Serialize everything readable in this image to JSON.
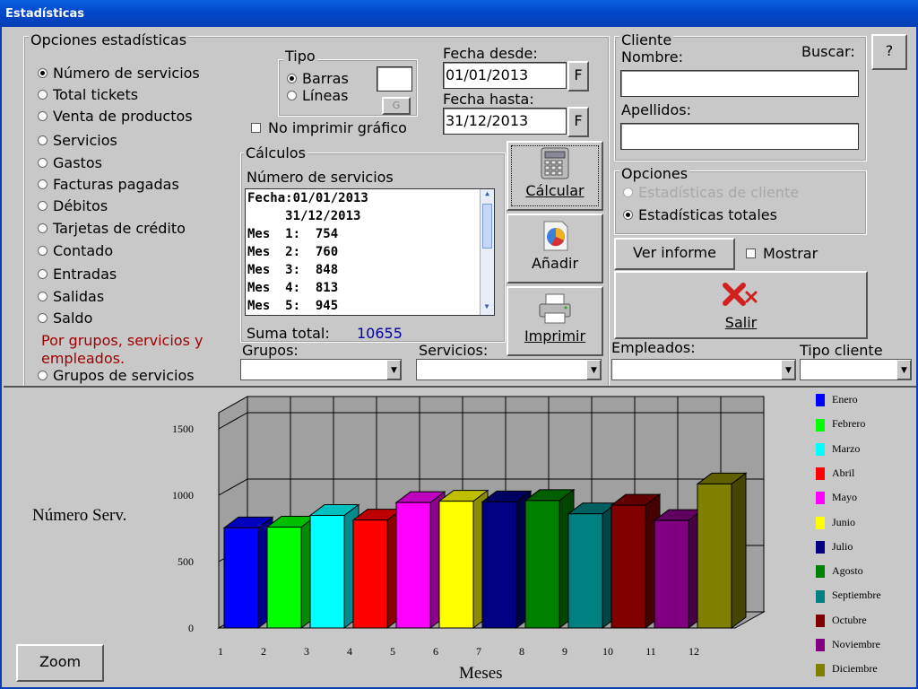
{
  "window": {
    "title": "Estadísticas"
  },
  "options": {
    "title": "Opciones estadísticas",
    "items": [
      "Número de servicios",
      "Total tickets",
      "Venta de productos",
      "Servicios",
      "Gastos",
      "Facturas pagadas",
      "Débitos",
      "Tarjetas de crédito",
      "Contado",
      "Entradas",
      "Salidas",
      "Saldo"
    ],
    "selected_index": 0,
    "group_note": "Por grupos, servicios y empleados.",
    "grupos_servicios": "Grupos de servicios"
  },
  "tipo": {
    "title": "Tipo",
    "barras": "Barras",
    "lineas": "Líneas",
    "g_button": "G",
    "selected": "Barras"
  },
  "no_imprimir": "No imprimir gráfico",
  "fechas": {
    "desde_label": "Fecha desde:",
    "desde_value": "01/01/2013",
    "hasta_label": "Fecha hasta:",
    "hasta_value": "31/12/2013",
    "f_button": "F"
  },
  "calculos": {
    "title": "Cálculos",
    "subtitle": "Número de servicios",
    "lines": [
      "Fecha:01/01/2013",
      "     31/12/2013",
      "Mes  1:  754",
      "Mes  2:  760",
      "Mes  3:  848",
      "Mes  4:  813",
      "Mes  5:  945"
    ],
    "suma_label": "Suma total:",
    "suma_value": "10655"
  },
  "actions": {
    "calcular": "Cálcular",
    "anadir": "Añadir",
    "imprimir": "Imprimir"
  },
  "cliente": {
    "title": "Cliente",
    "nombre_label": "Nombre:",
    "buscar_label": "Buscar:",
    "apellidos_label": "Apellidos:",
    "help_button": "?"
  },
  "opciones": {
    "title": "Opciones",
    "estadisticas_cliente": "Estadísticas de cliente",
    "estadisticas_totales": "Estadísticas totales"
  },
  "ver_informe": "Ver informe",
  "mostrar": "Mostrar",
  "salir": "Salir",
  "filters": {
    "grupos": "Grupos:",
    "servicios": "Servicios:",
    "empleados": "Empleados:",
    "tipo_cliente": "Tipo cliente"
  },
  "zoom": "Zoom",
  "chart_data": {
    "type": "bar",
    "categories": [
      "1",
      "2",
      "3",
      "4",
      "5",
      "6",
      "7",
      "8",
      "9",
      "10",
      "11",
      "12"
    ],
    "values": [
      754,
      760,
      848,
      813,
      945,
      955,
      950,
      960,
      860,
      925,
      810,
      1085
    ],
    "ylabel": "Número Serv.",
    "xlabel": "Meses",
    "yticks": [
      0,
      500,
      1000,
      1500
    ],
    "ylim": [
      0,
      1500
    ],
    "legend": [
      "Enero",
      "Febrero",
      "Marzo",
      "Abril",
      "Mayo",
      "Junio",
      "Julio",
      "Agosto",
      "Septiembre",
      "Octubre",
      "Noviembre",
      "Diciembre"
    ],
    "colors": [
      "#0000ff",
      "#00ff00",
      "#00ffff",
      "#ff0000",
      "#ff00ff",
      "#ffff00",
      "#000080",
      "#008000",
      "#008080",
      "#800000",
      "#800080",
      "#808000"
    ],
    "grid": true,
    "legend_position": "right"
  }
}
